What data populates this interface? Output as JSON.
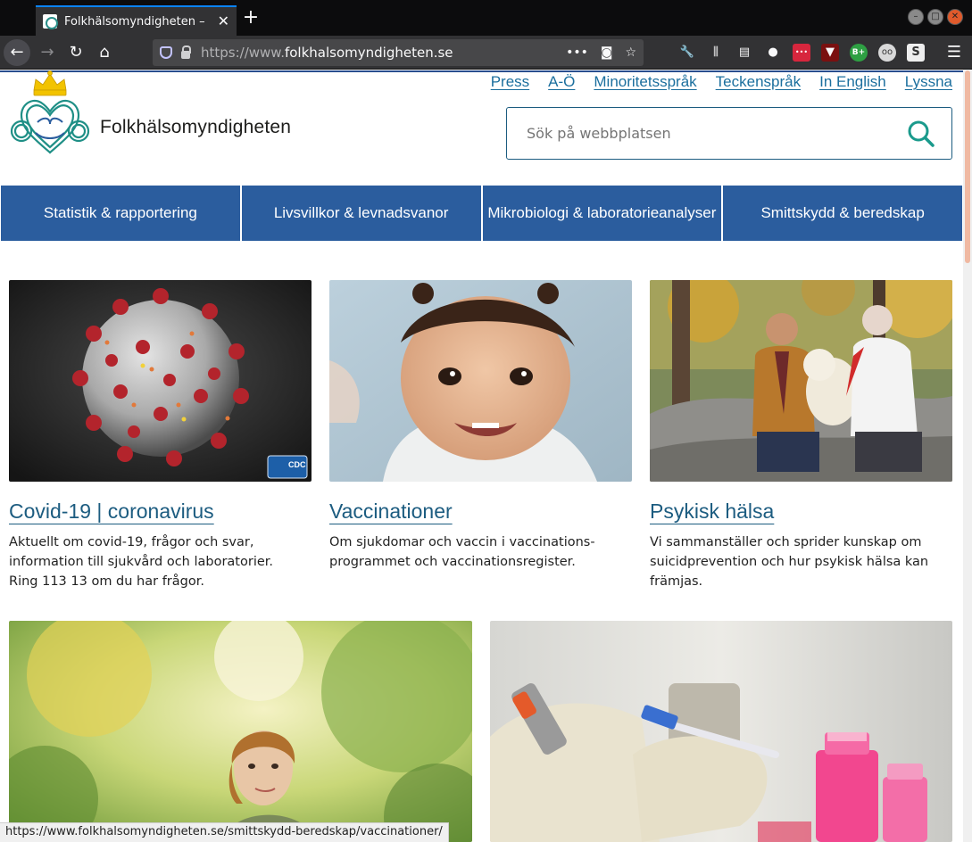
{
  "browser": {
    "tab_title": "Folkhälsomyndigheten –",
    "url_prefix": "https://www.",
    "url_domain": "folkhalsomyndigheten.se",
    "status_url": "https://www.folkhalsomyndigheten.se/smittskydd-beredskap/vaccinationer/",
    "toolbar_icons": [
      "wrench-icon",
      "library-icon",
      "sidebar-icon",
      "account-icon",
      "extension-red-icon",
      "extension-dark-icon",
      "extension-green-icon",
      "extension-owl-icon",
      "extension-s-icon"
    ]
  },
  "site": {
    "logo_text": "Folkhälsomyndigheten",
    "top_links": [
      "Press",
      "A-Ö",
      "Minoritetsspråk",
      "Teckenspråk",
      "In English",
      "Lyssna"
    ],
    "search_placeholder": "Sök på webbplatsen",
    "main_nav": [
      "Statistik & rapportering",
      "Livsvillkor & levnadsvanor",
      "Mikrobiologi & laboratorieanalyser",
      "Smittskydd & beredskap"
    ],
    "cards": [
      {
        "title": "Covid-19 | coronavirus",
        "desc_lines": [
          "Aktuellt om covid-19, frågor och svar,",
          "information till sjukvård och laboratorier.",
          "Ring 113 13 om du har frågor."
        ],
        "badge": "CDC"
      },
      {
        "title": "Vaccinationer",
        "desc_lines": [
          "Om sjukdomar och vaccin i vaccinations-",
          "programmet och vaccinationsregister."
        ]
      },
      {
        "title": "Psykisk hälsa",
        "desc_lines": [
          "Vi sammanställer och sprider kunskap om",
          "suicidprevention och hur psykisk hälsa kan",
          "främjas."
        ]
      }
    ]
  },
  "colors": {
    "nav_blue": "#2b5d9e",
    "link_blue": "#1c6f9e",
    "logo_teal": "#2a9d8f",
    "crown_yellow": "#f2c300"
  }
}
